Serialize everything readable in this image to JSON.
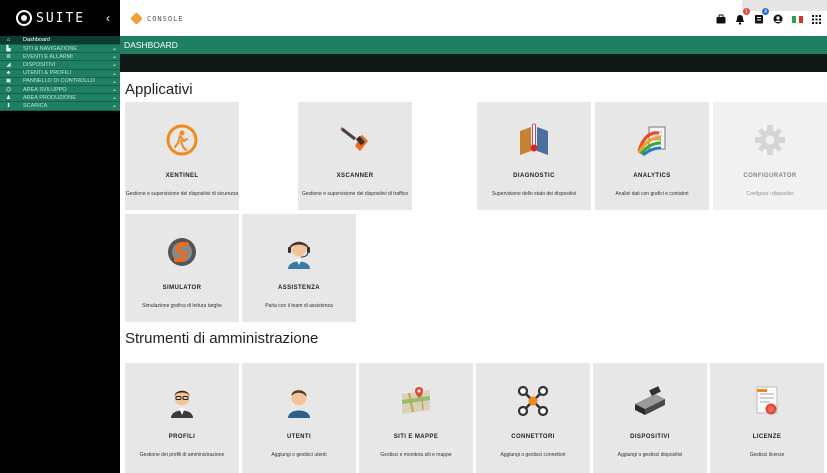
{
  "brand": {
    "name": "SUITE",
    "collapse": "‹"
  },
  "sidebar": {
    "items": [
      {
        "label": "Dashboard",
        "icon": "home-icon",
        "glyph": "⌂"
      },
      {
        "label": "SITI & NAVIGAZIONE",
        "icon": "building-icon",
        "glyph": "▙"
      },
      {
        "label": "EVENTI E ALLARMI",
        "icon": "alarm-icon",
        "glyph": "≣"
      },
      {
        "label": "DISPOSITIVI",
        "icon": "device-icon",
        "glyph": "◢"
      },
      {
        "label": "UTENTI & PROFILI",
        "icon": "users-icon",
        "glyph": "♣"
      },
      {
        "label": "PANNELLO DI CONTROLLO",
        "icon": "panel-icon",
        "glyph": "▣"
      },
      {
        "label": "AREA SVILUPPO",
        "icon": "dev-icon",
        "glyph": "⌬"
      },
      {
        "label": "AREA PRODUZIONE",
        "icon": "production-icon",
        "glyph": "♟"
      },
      {
        "label": "SCARICA",
        "icon": "download-icon",
        "glyph": "⬇"
      }
    ]
  },
  "topbar": {
    "console_label": "CONSOLE",
    "icons": [
      "briefcase-icon",
      "bell-icon",
      "task-icon",
      "user-icon",
      "flag-it-icon",
      "apps-icon"
    ],
    "bell_badge": "1",
    "task_badge": "4"
  },
  "header": {
    "title": "DASHBOARD"
  },
  "sections": {
    "applicativi": "Applicativi",
    "admin": "Strumenti di amministrazione"
  },
  "apps": [
    {
      "name": "XENTINEL",
      "desc": "Gestione e supervisione dei dispositivi di sicurezza"
    },
    {
      "name": "XSCANNER",
      "desc": "Gestione e supervisione dei dispositivi di traffico"
    },
    {
      "name": "DIAGNOSTIC",
      "desc": "Supervisione dello stato dei dispositivi"
    },
    {
      "name": "ANALYTICS",
      "desc": "Analisi dati con grafici e contatori"
    },
    {
      "name": "CONFIGURATOR",
      "desc": "Configura i dispositivi"
    },
    {
      "name": "SIMULATOR",
      "desc": "Simulazione grafica di lettura targhe"
    },
    {
      "name": "ASSISTENZA",
      "desc": "Parla con il team di assistenza"
    }
  ],
  "tools": [
    {
      "name": "PROFILI",
      "desc": "Gestione dei profili di amministrazione"
    },
    {
      "name": "UTENTI",
      "desc": "Aggiungi o gestisci utenti"
    },
    {
      "name": "SITI E MAPPE",
      "desc": "Gestisci e monitora siti e mappe"
    },
    {
      "name": "CONNETTORI",
      "desc": "Aggiungi o gestisci connettori"
    },
    {
      "name": "DISPOSITIVI",
      "desc": "Aggiungi o gestisci dispositivi"
    },
    {
      "name": "LICENZE",
      "desc": "Gestisci licenze"
    }
  ],
  "colors": {
    "accent": "#1f7f62",
    "dark": "#0f1a17",
    "card": "#e7e7e7",
    "orange": "#f0a13b"
  }
}
